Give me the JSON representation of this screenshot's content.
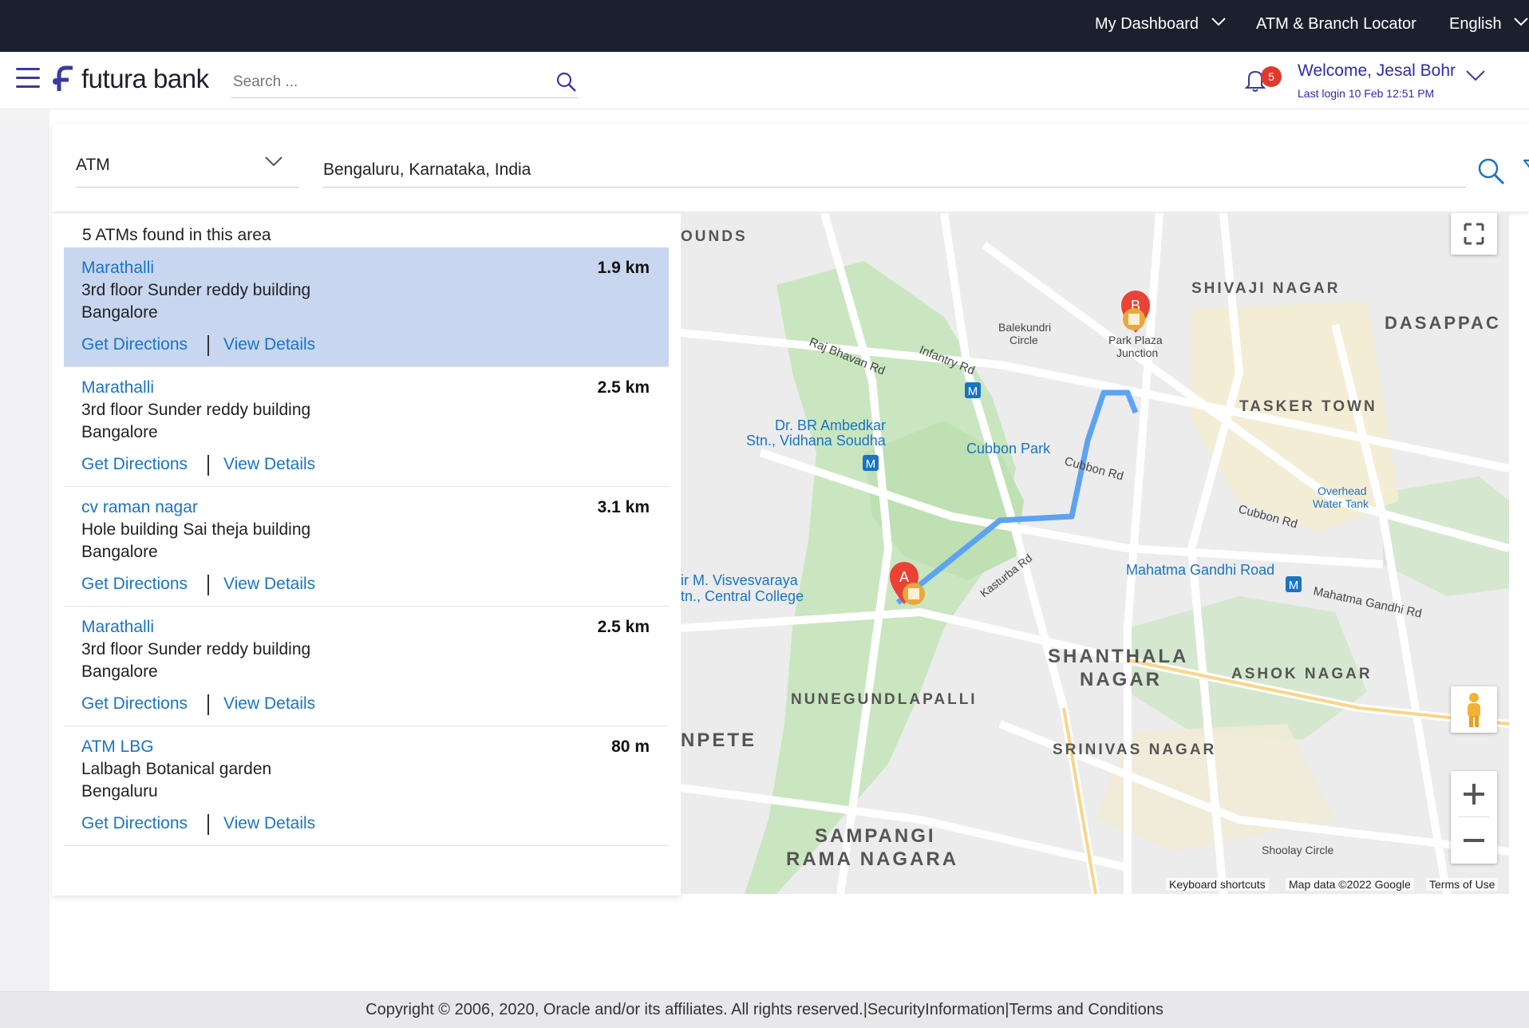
{
  "topbar": {
    "dashboard": "My Dashboard",
    "locator": "ATM & Branch Locator",
    "language": "English"
  },
  "header": {
    "brand": "futura bank",
    "search_placeholder": "Search ...",
    "notifications": "5",
    "welcome": "Welcome, Jesal Bohr",
    "last_login": "Last login 10 Feb 12:51 PM"
  },
  "filter": {
    "type": "ATM",
    "location": "Bengaluru, Karnataka, India"
  },
  "results": {
    "count_text": "5 ATMs found in this area",
    "items": [
      {
        "name": "Marathalli",
        "addr1": "3rd floor Sunder reddy building",
        "addr2": "Bangalore",
        "distance": "1.9 km",
        "directions": "Get Directions",
        "details": "View Details"
      },
      {
        "name": "Marathalli",
        "addr1": "3rd floor Sunder reddy building",
        "addr2": "Bangalore",
        "distance": "2.5 km",
        "directions": "Get Directions",
        "details": "View Details"
      },
      {
        "name": "cv raman nagar",
        "addr1": "Hole building Sai theja building",
        "addr2": "Bangalore",
        "distance": "3.1 km",
        "directions": "Get Directions",
        "details": "View Details"
      },
      {
        "name": "Marathalli",
        "addr1": "3rd floor Sunder reddy building",
        "addr2": "Bangalore",
        "distance": "2.5 km",
        "directions": "Get Directions",
        "details": "View Details"
      },
      {
        "name": "ATM LBG",
        "addr1": "Lalbagh Botanical garden",
        "addr2": "Bengaluru",
        "distance": "80 m",
        "directions": "Get Directions",
        "details": "View Details"
      }
    ]
  },
  "map": {
    "labels": {
      "shivaji": "SHIVAJI NAGAR",
      "tasker": "TASKER TOWN",
      "ambedkar": "Dr. BR Ambedkar",
      "vidhana": "Stn., Vidhana Soudha",
      "cubbon_park": "Cubbon Park",
      "cubbon_rd": "Cubbon Rd",
      "mg_road": "Mahatma Gandhi Road",
      "mg_rd": "Mahatma Gandhi Rd",
      "shanthala": "SHANTHALA",
      "nagar": "NAGAR",
      "ashok": "ASHOK NAGAR",
      "srinivas": "SRINIVAS NAGAR",
      "nunegundlapalli": "NUNEGUNDLAPALLI",
      "sampangi": "SAMPANGI",
      "rama_nagara": "RAMA NAGARA",
      "visvesvaraya": "ir M. Visvesvaraya",
      "central_college": "tn., Central College",
      "balekundri": "Balekundri",
      "circle": "Circle",
      "park_plaza": "Park Plaza",
      "junction": "Junction",
      "overhead": "Overhead",
      "water_tank": "Water Tank",
      "dasappa": "DASAPPAC",
      "shooley": "Shoolay Circle",
      "raj_bhavan": "Raj Bhavan Rd",
      "infantry": "Infantry Rd",
      "kasturba": "Kasturba Rd",
      "pete": "NPETE",
      "unds": "OUNDS",
      "marker_a": "A",
      "marker_b": "B"
    },
    "footer": {
      "shortcuts": "Keyboard shortcuts",
      "mapdata": "Map data ©2022 Google",
      "terms": "Terms of Use"
    }
  },
  "footer": {
    "text": "Copyright © 2006, 2020, Oracle and/or its affiliates. All rights reserved.|SecurityInformation|Terms and Conditions"
  }
}
